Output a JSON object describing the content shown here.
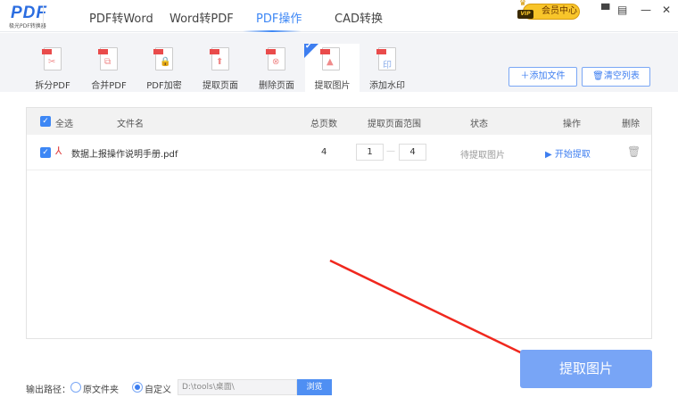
{
  "app": {
    "logo": "PDF",
    "logo_sub": "极光PDF转换器"
  },
  "tabs": [
    {
      "label": "PDF转Word"
    },
    {
      "label": "Word转PDF"
    },
    {
      "label": "PDF操作",
      "active": true
    },
    {
      "label": "CAD转换"
    }
  ],
  "vip": {
    "badge": "VIP",
    "label": "会员中心"
  },
  "tools": [
    {
      "label": "拆分PDF",
      "icon": "✂"
    },
    {
      "label": "合并PDF",
      "icon": "⧉"
    },
    {
      "label": "PDF加密",
      "icon": "🔒"
    },
    {
      "label": "提取页面",
      "icon": "⬆"
    },
    {
      "label": "删除页面",
      "icon": "⊗"
    },
    {
      "label": "提取图片",
      "icon": "▲",
      "active": true
    },
    {
      "label": "添加水印",
      "icon": "印"
    }
  ],
  "buttons": {
    "add_file": "添加文件",
    "clear_list": "清空列表",
    "extract": "提取图片",
    "browse": "浏览"
  },
  "table": {
    "headers": {
      "select_all": "全选",
      "filename": "文件名",
      "pages": "总页数",
      "range": "提取页面范围",
      "status": "状态",
      "action": "操作",
      "delete": "删除"
    },
    "rows": [
      {
        "checked": true,
        "filename": "数据上报操作说明手册.pdf",
        "pages": "4",
        "range_from": "1",
        "range_sep": "—",
        "range_to": "4",
        "status": "待提取图片",
        "action": "开始提取"
      }
    ]
  },
  "output": {
    "label": "输出路径：",
    "option_original": "原文件夹",
    "option_custom": "自定义",
    "selected": "自定义",
    "path": "D:\\tools\\桌面\\"
  },
  "colors": {
    "accent": "#3d87f5",
    "button": "#78a5f6",
    "arrow": "#f0281e"
  }
}
